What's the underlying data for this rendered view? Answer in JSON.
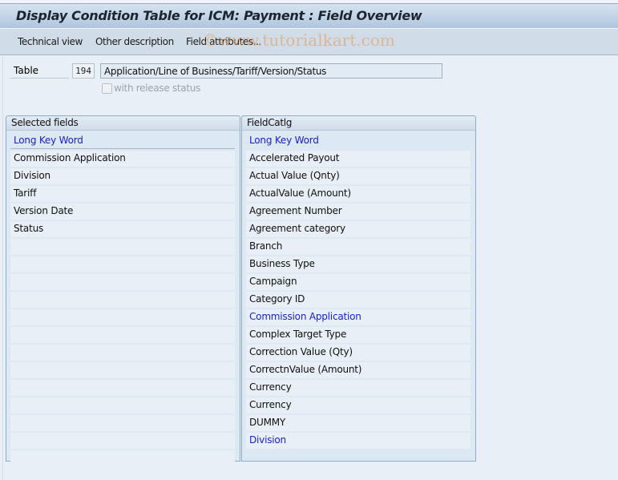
{
  "window": {
    "title": "Display Condition Table for ICM: Payment : Field Overview"
  },
  "toolbar": {
    "buttons": [
      {
        "label": "Technical view"
      },
      {
        "label": "Other description"
      },
      {
        "label": "Field attributes..."
      }
    ]
  },
  "watermark": "©www.tutorialkart.com",
  "form": {
    "table_label": "Table",
    "table_number": "194",
    "table_description": "Application/Line of Business/Tariff/Version/Status",
    "release_status_label": "with release status",
    "release_status_checked": false,
    "release_status_enabled": false
  },
  "selected_fields": {
    "title": "Selected fields",
    "column_header": "Long Key Word",
    "rows": [
      "Commission Application",
      "Division",
      "Tariff",
      "Version Date",
      "Status",
      "",
      "",
      "",
      "",
      "",
      "",
      "",
      "",
      "",
      "",
      "",
      "",
      ""
    ]
  },
  "field_catalog": {
    "title": "FieldCatlg",
    "column_header": "Long Key Word",
    "rows": [
      {
        "text": "Accelerated Payout",
        "highlighted": false
      },
      {
        "text": "Actual Value (Qnty)",
        "highlighted": false
      },
      {
        "text": "ActualValue (Amount)",
        "highlighted": false
      },
      {
        "text": "Agreement Number",
        "highlighted": false
      },
      {
        "text": "Agreement category",
        "highlighted": false
      },
      {
        "text": "Branch",
        "highlighted": false
      },
      {
        "text": "Business Type",
        "highlighted": false
      },
      {
        "text": "Campaign",
        "highlighted": false
      },
      {
        "text": "Category ID",
        "highlighted": false
      },
      {
        "text": "Commission Application",
        "highlighted": true
      },
      {
        "text": "Complex Target Type",
        "highlighted": false
      },
      {
        "text": "Correction Value (Qty)",
        "highlighted": false
      },
      {
        "text": "CorrectnValue (Amount)",
        "highlighted": false
      },
      {
        "text": "Currency",
        "highlighted": false
      },
      {
        "text": "Currency",
        "highlighted": false
      },
      {
        "text": "DUMMY",
        "highlighted": false
      },
      {
        "text": "Division",
        "highlighted": true
      }
    ]
  }
}
